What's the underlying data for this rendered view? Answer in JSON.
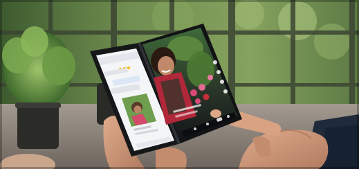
{
  "image": {
    "title": "",
    "subject": "photo-foldable-dual-screen-phone",
    "palette": {
      "bg_green": "#5f7e49",
      "bg_dark": "#1c2219",
      "railing": "#3d4733",
      "floor": "#8a7f76",
      "phone_frame": "#151719",
      "left_screen": "#f4f5f7",
      "chat_bubble": "#dbe6f6",
      "right_screen_dark": "#1a1a22",
      "skin": "#c89478",
      "sleeve": "#1f2a3a",
      "flower_pink": "#d94a7a",
      "flower_red": "#c72d3a",
      "shirt_red": "#b0283a"
    }
  }
}
